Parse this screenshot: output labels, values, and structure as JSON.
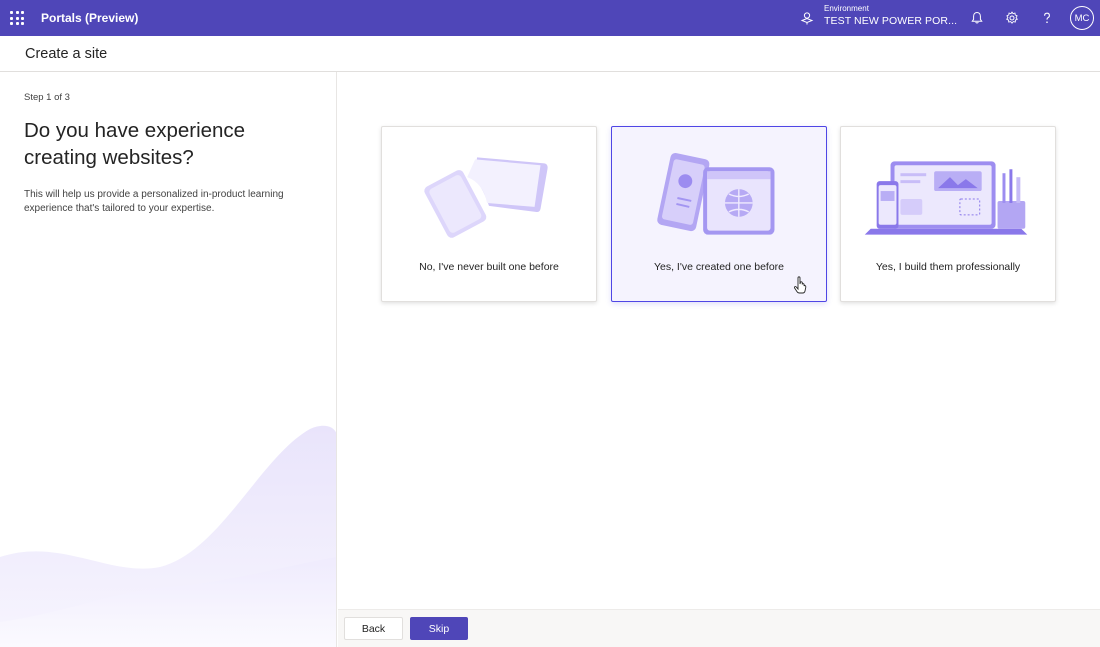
{
  "topbar": {
    "app_title": "Portals (Preview)",
    "environment_label": "Environment",
    "environment_value": "TEST NEW POWER POR...",
    "avatar_initials": "MC",
    "icons": [
      "waffle-icon",
      "environment-icon",
      "bell-icon",
      "gear-icon",
      "help-icon"
    ]
  },
  "subheader": {
    "title": "Create a site"
  },
  "left": {
    "step": "Step 1 of 3",
    "question": "Do you have experience creating websites?",
    "description": "This will help us provide a personalized in-product learning experience that's tailored to your expertise."
  },
  "options": [
    {
      "label": "No, I've never built one before",
      "selected": false
    },
    {
      "label": "Yes, I've created one before",
      "selected": true
    },
    {
      "label": "Yes, I build them professionally",
      "selected": false
    }
  ],
  "footer": {
    "back_label": "Back",
    "skip_label": "Skip"
  },
  "colors": {
    "header": "#4f46b8",
    "accent": "#4f46e5",
    "illustration": "#a99cf0",
    "wave": "#eeeafc"
  }
}
